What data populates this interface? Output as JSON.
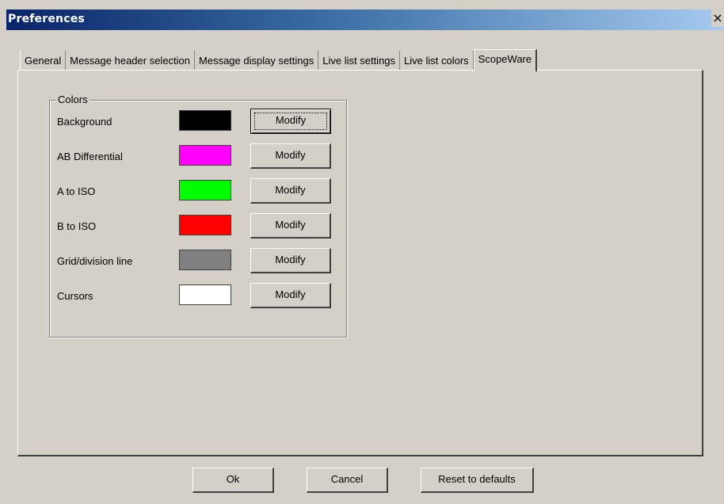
{
  "window": {
    "title": "Preferences",
    "close_glyph": "×"
  },
  "tabs": [
    {
      "label": "General",
      "active": false
    },
    {
      "label": "Message header selection",
      "active": false
    },
    {
      "label": "Message display settings",
      "active": false
    },
    {
      "label": "Live list settings",
      "active": false
    },
    {
      "label": "Live list colors",
      "active": false
    },
    {
      "label": "ScopeWare",
      "active": true
    }
  ],
  "colors_group": {
    "title": "Colors",
    "rows": [
      {
        "label": "Background",
        "color": "#000000",
        "button": "Modify"
      },
      {
        "label": "AB Differential",
        "color": "#ff00ff",
        "button": "Modify"
      },
      {
        "label": "A to ISO",
        "color": "#00ff00",
        "button": "Modify"
      },
      {
        "label": "B to ISO",
        "color": "#ff0000",
        "button": "Modify"
      },
      {
        "label": "Grid/division line",
        "color": "#808080",
        "button": "Modify"
      },
      {
        "label": "Cursors",
        "color": "#ffffff",
        "button": "Modify"
      }
    ]
  },
  "footer": {
    "ok_label": "Ok",
    "cancel_label": "Cancel",
    "reset_label": "Reset to defaults"
  },
  "icons": {
    "close": "close-icon"
  }
}
